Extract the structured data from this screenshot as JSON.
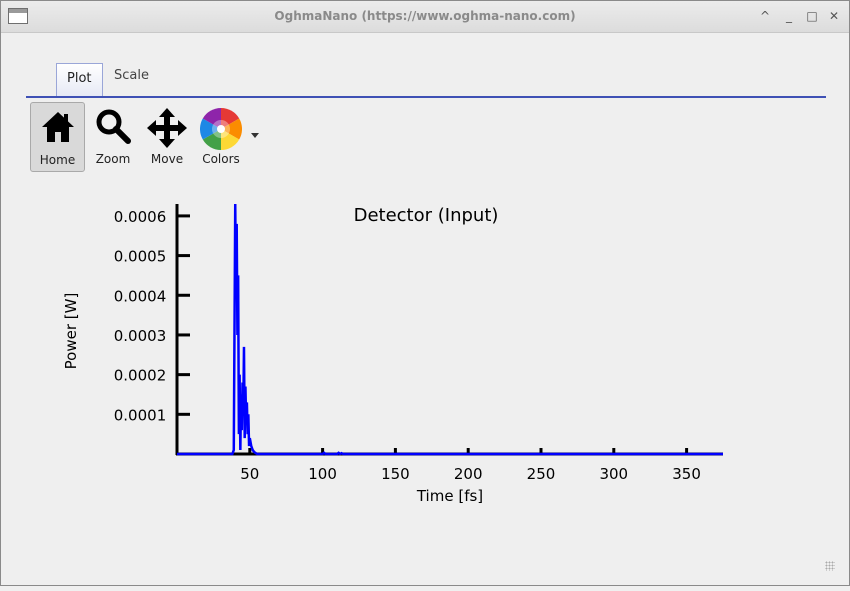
{
  "window": {
    "title": "OghmaNano (https://www.oghma-nano.com)",
    "controls": {
      "shade": "^",
      "minimize": "_",
      "maximize": "□",
      "close": "✕"
    }
  },
  "tabs": [
    {
      "label": "Plot",
      "active": true
    },
    {
      "label": "Scale",
      "active": false
    }
  ],
  "toolbar": {
    "home": {
      "label": "Home",
      "icon": "home-icon",
      "pressed": true
    },
    "zoom": {
      "label": "Zoom",
      "icon": "magnifier-icon"
    },
    "move": {
      "label": "Move",
      "icon": "move-arrows-icon"
    },
    "colors": {
      "label": "Colors",
      "icon": "color-wheel-icon",
      "has_dropdown": true
    }
  },
  "chart_data": {
    "type": "line",
    "title": "Detector (Input)",
    "xlabel": "Time [fs]",
    "ylabel": "Power [W]",
    "xlim": [
      0,
      375
    ],
    "ylim": [
      0,
      0.00063
    ],
    "x_ticks": [
      50,
      100,
      150,
      200,
      250,
      300,
      350
    ],
    "y_ticks": [
      0.0001,
      0.0002,
      0.0003,
      0.0004,
      0.0005,
      0.0006
    ],
    "y_tick_labels": [
      "0.0001",
      "0.0002",
      "0.0003",
      "0.0004",
      "0.0005",
      "0.0006"
    ],
    "grid": false,
    "color": "#0000ff",
    "series": [
      {
        "x": [
          0,
          38,
          39,
          40,
          40.5,
          41,
          41.5,
          42,
          42.5,
          43,
          43.5,
          44,
          44.5,
          45,
          45.5,
          46,
          46.5,
          47,
          47.5,
          48,
          48.5,
          49,
          49.5,
          50,
          51,
          52,
          53,
          55,
          60,
          100,
          101,
          102,
          110,
          111,
          112,
          113,
          114,
          120,
          375
        ],
        "y": [
          0,
          0,
          1e-05,
          0.00063,
          0.0004,
          0.00058,
          0.0003,
          0.00045,
          5e-05,
          0.0002,
          1e-05,
          0.00015,
          6e-05,
          0.00018,
          0.0001,
          0.00027,
          4e-05,
          0.00017,
          8e-05,
          0.00013,
          5e-05,
          0.0001,
          2e-05,
          4e-05,
          2e-05,
          1e-05,
          5e-06,
          0,
          0,
          0,
          3e-06,
          0,
          0,
          3e-06,
          0,
          2e-06,
          0,
          0,
          0
        ]
      }
    ]
  }
}
